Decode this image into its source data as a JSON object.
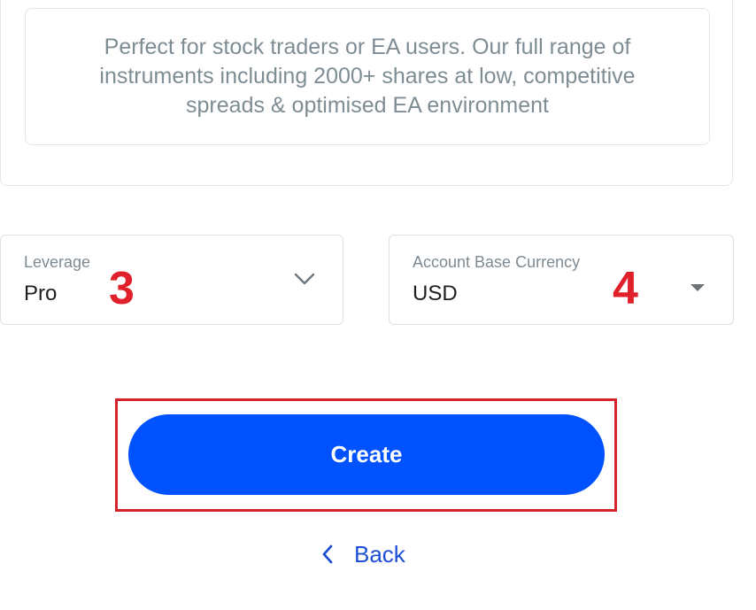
{
  "account_type_card": {
    "description": "Perfect for stock traders or EA users. Our full range of instruments including 2000+ shares at low, competitive spreads & optimised EA environment"
  },
  "leverage_field": {
    "label": "Leverage",
    "value": "Pro",
    "icon": "chevron-down-icon"
  },
  "currency_field": {
    "label": "Account Base Currency",
    "value": "USD",
    "icon": "caret-down-icon"
  },
  "annotations": {
    "step_3": "3",
    "step_4": "4"
  },
  "actions": {
    "create_label": "Create",
    "back_label": "Back"
  },
  "colors": {
    "primary_button": "#0052ff",
    "link": "#1c4fd6",
    "annotation_red": "#e0202b",
    "highlight_border": "#d4232b"
  }
}
